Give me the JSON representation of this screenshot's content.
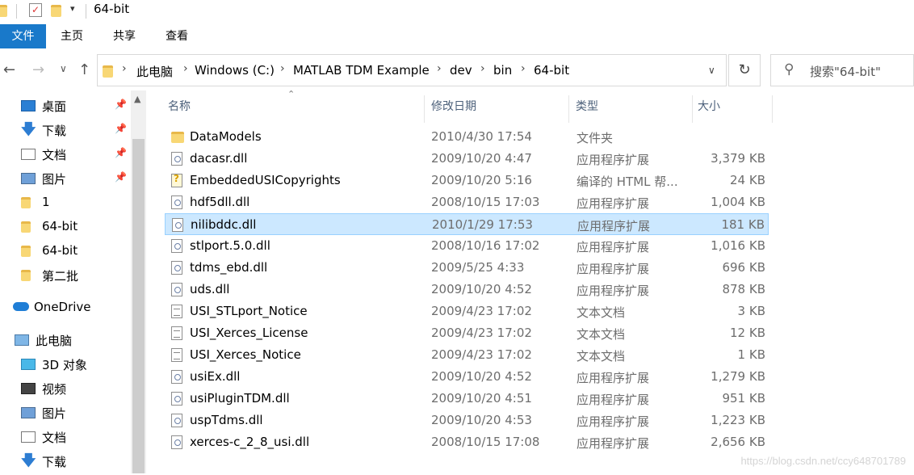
{
  "window": {
    "title": "64-bit"
  },
  "ribbon": {
    "tabs": [
      "文件",
      "主页",
      "共享",
      "查看"
    ]
  },
  "address": {
    "crumbs": [
      "此电脑",
      "Windows (C:)",
      "MATLAB TDM Example",
      "dev",
      "bin",
      "64-bit"
    ]
  },
  "search": {
    "placeholder": "搜索\"64-bit\""
  },
  "sidebar": {
    "items": [
      {
        "label": "桌面",
        "icon": "desktop-icon",
        "pinned": true
      },
      {
        "label": "下载",
        "icon": "download-icon",
        "pinned": true
      },
      {
        "label": "文档",
        "icon": "document-icon",
        "pinned": true
      },
      {
        "label": "图片",
        "icon": "picture-icon",
        "pinned": true
      },
      {
        "label": "1",
        "icon": "folder-icon",
        "pinned": false
      },
      {
        "label": "64-bit",
        "icon": "folder-icon",
        "pinned": false
      },
      {
        "label": "64-bit",
        "icon": "folder-icon",
        "pinned": false
      },
      {
        "label": "第二批",
        "icon": "folder-icon",
        "pinned": false
      },
      {
        "label": "OneDrive",
        "icon": "cloud-icon",
        "pinned": false
      },
      {
        "label": "此电脑",
        "icon": "computer-icon",
        "pinned": false
      },
      {
        "label": "3D 对象",
        "icon": "cube-icon",
        "pinned": false
      },
      {
        "label": "视频",
        "icon": "video-icon",
        "pinned": false
      },
      {
        "label": "图片",
        "icon": "picture-icon",
        "pinned": false
      },
      {
        "label": "文档",
        "icon": "document-icon",
        "pinned": false
      },
      {
        "label": "下载",
        "icon": "download-icon",
        "pinned": false
      }
    ]
  },
  "columns": {
    "name": "名称",
    "date": "修改日期",
    "type": "类型",
    "size": "大小"
  },
  "files": [
    {
      "name": "DataModels",
      "date": "2010/4/30 17:54",
      "type": "文件夹",
      "size": "",
      "icon": "folder",
      "selected": false
    },
    {
      "name": "dacasr.dll",
      "date": "2009/10/20 4:47",
      "type": "应用程序扩展",
      "size": "3,379 KB",
      "icon": "dll",
      "selected": false
    },
    {
      "name": "EmbeddedUSICopyrights",
      "date": "2009/10/20 5:16",
      "type": "编译的 HTML 帮...",
      "size": "24 KB",
      "icon": "html",
      "selected": false
    },
    {
      "name": "hdf5dll.dll",
      "date": "2008/10/15 17:03",
      "type": "应用程序扩展",
      "size": "1,004 KB",
      "icon": "dll",
      "selected": false
    },
    {
      "name": "nilibddc.dll",
      "date": "2010/1/29 17:53",
      "type": "应用程序扩展",
      "size": "181 KB",
      "icon": "dll",
      "selected": true
    },
    {
      "name": "stlport.5.0.dll",
      "date": "2008/10/16 17:02",
      "type": "应用程序扩展",
      "size": "1,016 KB",
      "icon": "dll",
      "selected": false
    },
    {
      "name": "tdms_ebd.dll",
      "date": "2009/5/25 4:33",
      "type": "应用程序扩展",
      "size": "696 KB",
      "icon": "dll",
      "selected": false
    },
    {
      "name": "uds.dll",
      "date": "2009/10/20 4:52",
      "type": "应用程序扩展",
      "size": "878 KB",
      "icon": "dll",
      "selected": false
    },
    {
      "name": "USI_STLport_Notice",
      "date": "2009/4/23 17:02",
      "type": "文本文档",
      "size": "3 KB",
      "icon": "txt",
      "selected": false
    },
    {
      "name": "USI_Xerces_License",
      "date": "2009/4/23 17:02",
      "type": "文本文档",
      "size": "12 KB",
      "icon": "txt",
      "selected": false
    },
    {
      "name": "USI_Xerces_Notice",
      "date": "2009/4/23 17:02",
      "type": "文本文档",
      "size": "1 KB",
      "icon": "txt",
      "selected": false
    },
    {
      "name": "usiEx.dll",
      "date": "2009/10/20 4:52",
      "type": "应用程序扩展",
      "size": "1,279 KB",
      "icon": "dll",
      "selected": false
    },
    {
      "name": "usiPluginTDM.dll",
      "date": "2009/10/20 4:51",
      "type": "应用程序扩展",
      "size": "951 KB",
      "icon": "dll",
      "selected": false
    },
    {
      "name": "uspTdms.dll",
      "date": "2009/10/20 4:53",
      "type": "应用程序扩展",
      "size": "1,223 KB",
      "icon": "dll",
      "selected": false
    },
    {
      "name": "xerces-c_2_8_usi.dll",
      "date": "2008/10/15 17:08",
      "type": "应用程序扩展",
      "size": "2,656 KB",
      "icon": "dll",
      "selected": false
    }
  ],
  "watermark": "https://blog.csdn.net/ccy648701789",
  "colors": {
    "accent": "#1979ca",
    "selection": "#cce8ff",
    "selection_border": "#99d1ff"
  }
}
